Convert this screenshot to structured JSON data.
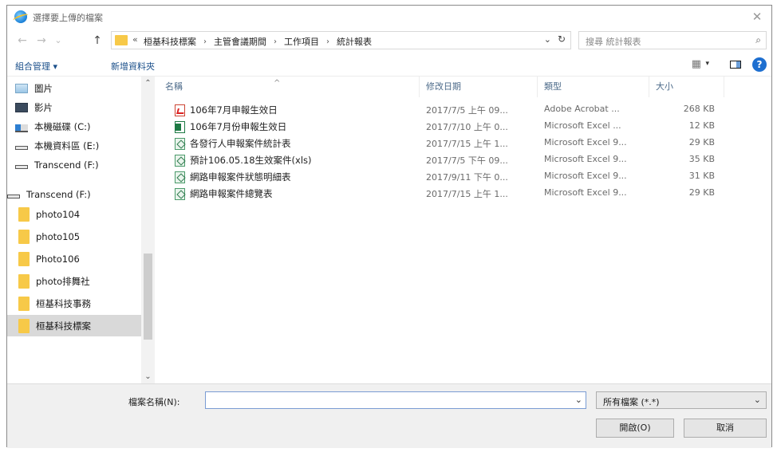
{
  "window": {
    "title": "選擇要上傳的檔案",
    "close_glyph": "✕"
  },
  "nav_buttons": {
    "back": "←",
    "forward": "→",
    "history": "⌄",
    "up": "↑"
  },
  "address": {
    "overflow": "«",
    "crumbs": [
      "桓基科技標案",
      "主管會議期間",
      "工作項目",
      "統計報表"
    ],
    "separator": "›",
    "dropdown": "⌄",
    "refresh": "↻"
  },
  "search": {
    "placeholder": "搜尋 統計報表",
    "icon": "⌕"
  },
  "toolbar": {
    "organize": "組合管理 ▾",
    "new_folder": "新增資料夾",
    "view_icon": "▦",
    "view_dd": "▾",
    "help": "?"
  },
  "nav_pane": {
    "items": [
      {
        "label": "圖片",
        "icon": "pictures"
      },
      {
        "label": "影片",
        "icon": "videos"
      },
      {
        "label": "本機磁碟 (C:)",
        "icon": "system-drive"
      },
      {
        "label": "本機資料區 (E:)",
        "icon": "drive"
      },
      {
        "label": "Transcend (F:)",
        "icon": "drive"
      },
      {
        "label": "Transcend (F:)",
        "icon": "drive"
      },
      {
        "label": "photo104",
        "icon": "folder"
      },
      {
        "label": "photo105",
        "icon": "folder"
      },
      {
        "label": "Photo106",
        "icon": "folder"
      },
      {
        "label": "photo排舞社",
        "icon": "folder"
      },
      {
        "label": "桓基科技事務",
        "icon": "folder"
      },
      {
        "label": "桓基科技標案",
        "icon": "folder",
        "selected": true
      }
    ],
    "scroll_up": "⌃",
    "scroll_down": "⌄"
  },
  "columns": {
    "name": "名稱",
    "modified": "修改日期",
    "type": "類型",
    "size": "大小",
    "sort_indicator": "^"
  },
  "files": [
    {
      "name": "106年7月申報生效日",
      "modified": "2017/7/5 上午 09...",
      "type": "Adobe Acrobat ...",
      "size": "268 KB",
      "icon": "pdf"
    },
    {
      "name": "106年7月份申報生效日",
      "modified": "2017/7/10 上午 0...",
      "type": "Microsoft Excel ...",
      "size": "12 KB",
      "icon": "xls"
    },
    {
      "name": "各發行人申報案件統計表",
      "modified": "2017/7/15 上午 1...",
      "type": "Microsoft Excel 9...",
      "size": "29 KB",
      "icon": "csv"
    },
    {
      "name": "預計106.05.18生效案件(xls)",
      "modified": "2017/7/5 下午 09...",
      "type": "Microsoft Excel 9...",
      "size": "35 KB",
      "icon": "csv"
    },
    {
      "name": "網路申報案件狀態明細表",
      "modified": "2017/9/11 下午 0...",
      "type": "Microsoft Excel 9...",
      "size": "31 KB",
      "icon": "csv"
    },
    {
      "name": "網路申報案件總覽表",
      "modified": "2017/7/15 上午 1...",
      "type": "Microsoft Excel 9...",
      "size": "29 KB",
      "icon": "csv"
    }
  ],
  "footer": {
    "filename_label": "檔案名稱(N):",
    "filename_value": "",
    "filename_dd": "⌄",
    "filetype": "所有檔案 (*.*)",
    "filetype_dd": "⌄",
    "open": "開啟(O)",
    "cancel": "取消"
  }
}
